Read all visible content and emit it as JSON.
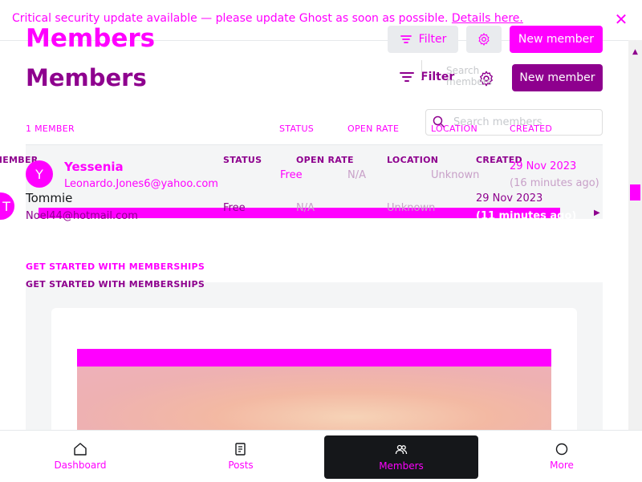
{
  "banner": {
    "message": "Critical security update available — please update Ghost as soon as possible.",
    "link_label": "Details here."
  },
  "header": {
    "title": "Members",
    "filter_label": "Filter",
    "new_member_label": "New member",
    "search_placeholder": "Search members"
  },
  "table": {
    "count_label": "1 MEMBER",
    "columns": [
      "STATUS",
      "OPEN RATE",
      "LOCATION",
      "CREATED"
    ],
    "columns_partial_first": "MEMBER",
    "rows": [
      {
        "avatar_letter": "Y",
        "name": "Yessenia",
        "email": "Leonardo.Jones6@yahoo.com",
        "status": "Free",
        "open_rate": "N/A",
        "location": "Unknown",
        "created": "29 Nov 2023",
        "created_ago": "(16 minutes ago)"
      },
      {
        "avatar_letter": "T",
        "name": "Tommie",
        "email": "Noel44@hotmail.com",
        "status": "Free",
        "open_rate": "N/A",
        "location": "Unknown",
        "created": "29 Nov 2023",
        "created_ago": "(11 minutes ago)"
      }
    ]
  },
  "memberships": {
    "heading": "GET STARTED WITH MEMBERSHIPS"
  },
  "bottom_nav": [
    {
      "label": "Dashboard",
      "icon": "home-icon"
    },
    {
      "label": "Posts",
      "icon": "posts-icon"
    },
    {
      "label": "Members",
      "icon": "members-icon",
      "active": true
    },
    {
      "label": "More",
      "icon": "more-icon"
    }
  ],
  "colors": {
    "accent_magenta": "#ff00ff",
    "accent_purple": "#8e008e",
    "dark": "#15171a"
  }
}
